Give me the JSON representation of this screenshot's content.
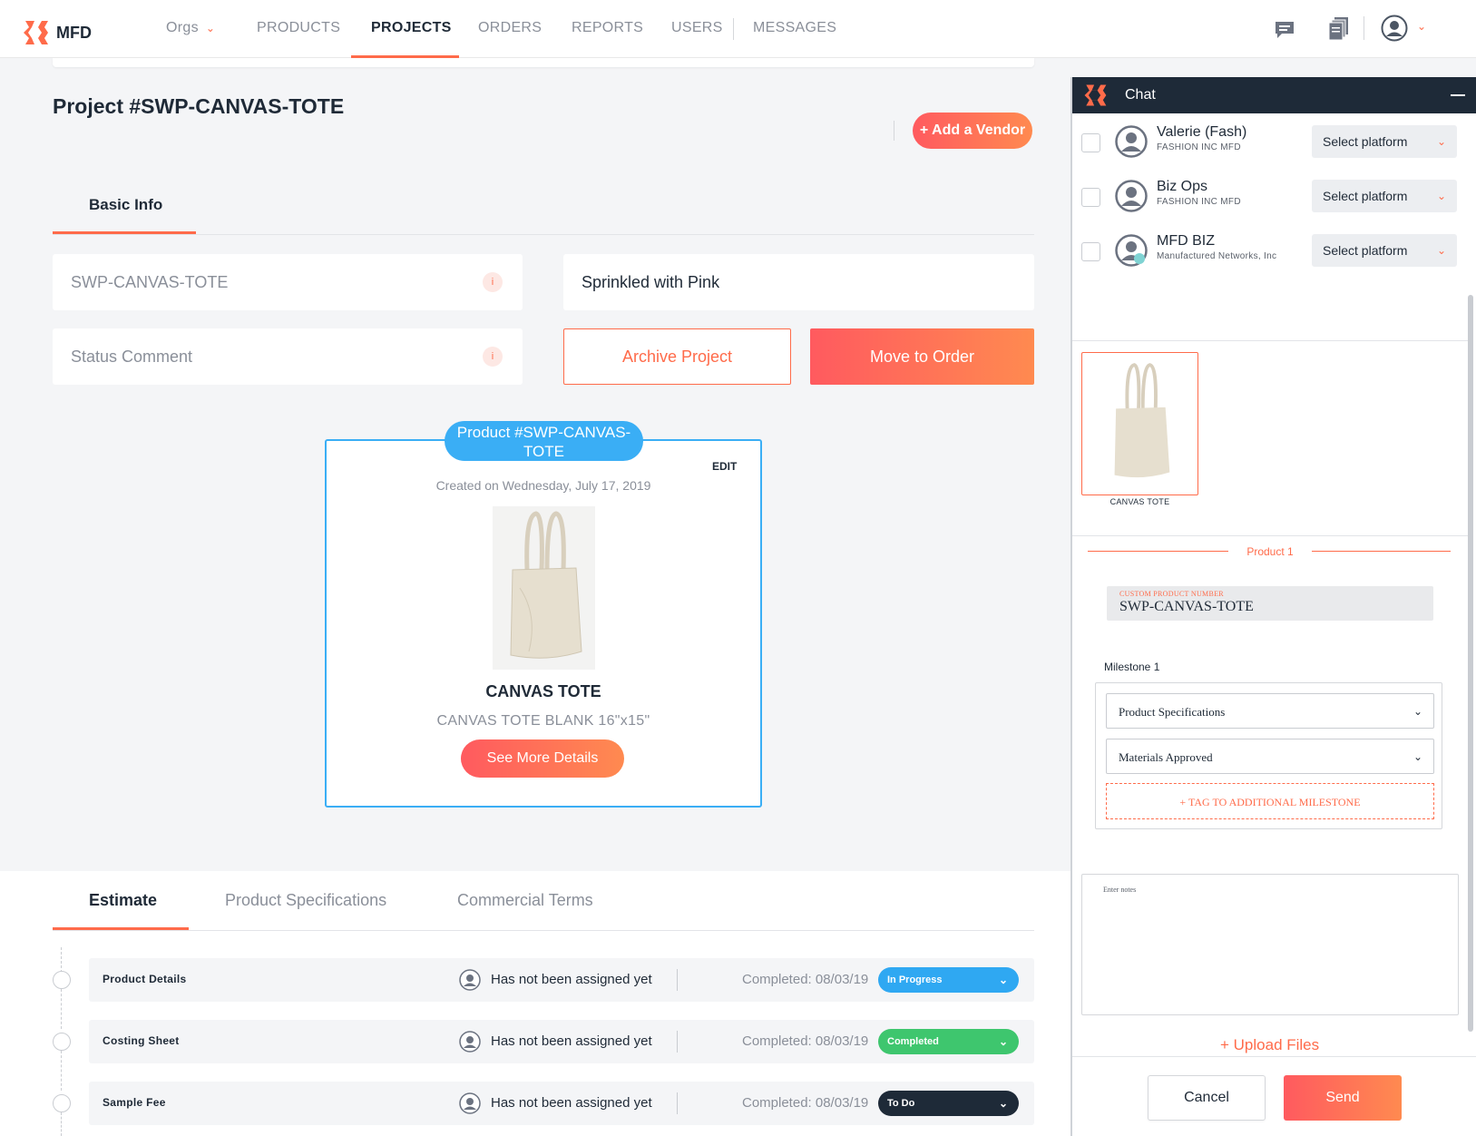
{
  "app": {
    "brand": "MFD"
  },
  "nav": {
    "orgs": "Orgs",
    "items": [
      "PRODUCTS",
      "PROJECTS",
      "ORDERS",
      "REPORTS",
      "USERS",
      "MESSAGES"
    ],
    "active": "PROJECTS",
    "icons": [
      "chat-bubble-icon",
      "documents-icon",
      "user-avatar-icon",
      "chevron-down-icon"
    ]
  },
  "project": {
    "title": "Project #SWP-CANVAS-TOTE",
    "add_vendor": "+ Add a Vendor",
    "tab": "Basic Info",
    "project_number": "SWP-CANVAS-TOTE",
    "brand_name": "Sprinkled with Pink",
    "status_comment_placeholder": "Status Comment",
    "info_glyph": "i",
    "archive": "Archive Project",
    "move_to_order": "Move to Order"
  },
  "product_card": {
    "badge": "Product #SWP-CANVAS-TOTE",
    "edit": "EDIT",
    "created": "Created on Wednesday, July 17, 2019",
    "name": "CANVAS TOTE",
    "description": "CANVAS TOTE BLANK 16\"x15\"",
    "see_more": "See More Details"
  },
  "bottom_tabs": {
    "items": [
      "Estimate",
      "Product Specifications",
      "Commercial Terms"
    ],
    "active": "Estimate"
  },
  "rows": [
    {
      "title": "Product Details",
      "assignee": "Has not been assigned yet",
      "completed": "Completed: 08/03/19",
      "status": "In Progress",
      "status_color": "#2fa8f2"
    },
    {
      "title": "Costing Sheet",
      "assignee": "Has not been assigned yet",
      "completed": "Completed: 08/03/19",
      "status": "Completed",
      "status_color": "#3ec66e"
    },
    {
      "title": "Sample Fee",
      "assignee": "Has not been assigned yet",
      "completed": "Completed: 08/03/19",
      "status": "To Do",
      "status_color": "#1e2a38"
    }
  ],
  "chat": {
    "title": "Chat",
    "contacts": [
      {
        "name": "Valerie (Fash)",
        "org": "FASHION INC MFD",
        "platform": "Select platform"
      },
      {
        "name": "Biz Ops",
        "org": "FASHION INC MFD",
        "platform": "Select platform"
      },
      {
        "name": "MFD BIZ",
        "org": "Manufactured Networks, Inc",
        "platform": "Select platform"
      }
    ],
    "thumb_label": "CANVAS TOTE",
    "product_label": "Product 1",
    "custom_product_number_label": "CUSTOM PRODUCT NUMBER",
    "custom_product_number": "SWP-CANVAS-TOTE",
    "milestone_title": "Milestone 1",
    "milestone_1": "Product Specifications",
    "milestone_2": "Materials Approved",
    "tag_additional": "+ TAG TO ADDITIONAL MILESTONE",
    "notes_placeholder": "Enter notes",
    "upload": "+ Upload Files",
    "cancel": "Cancel",
    "send": "Send"
  },
  "colors": {
    "accent": "#ff6b4a",
    "blue": "#3aaef5",
    "dark": "#1e2a38"
  }
}
